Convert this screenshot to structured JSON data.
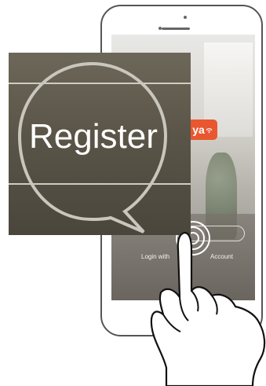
{
  "callout": {
    "label": "Register"
  },
  "app_screen": {
    "login_prefix": "Login with",
    "login_suffix": "Account",
    "logo_fragment": "ya",
    "brand_color": "#e8572f"
  },
  "icons": [
    "wifi-icon",
    "tap-ripple-icon",
    "pointing-hand-icon",
    "speech-bubble-icon"
  ]
}
